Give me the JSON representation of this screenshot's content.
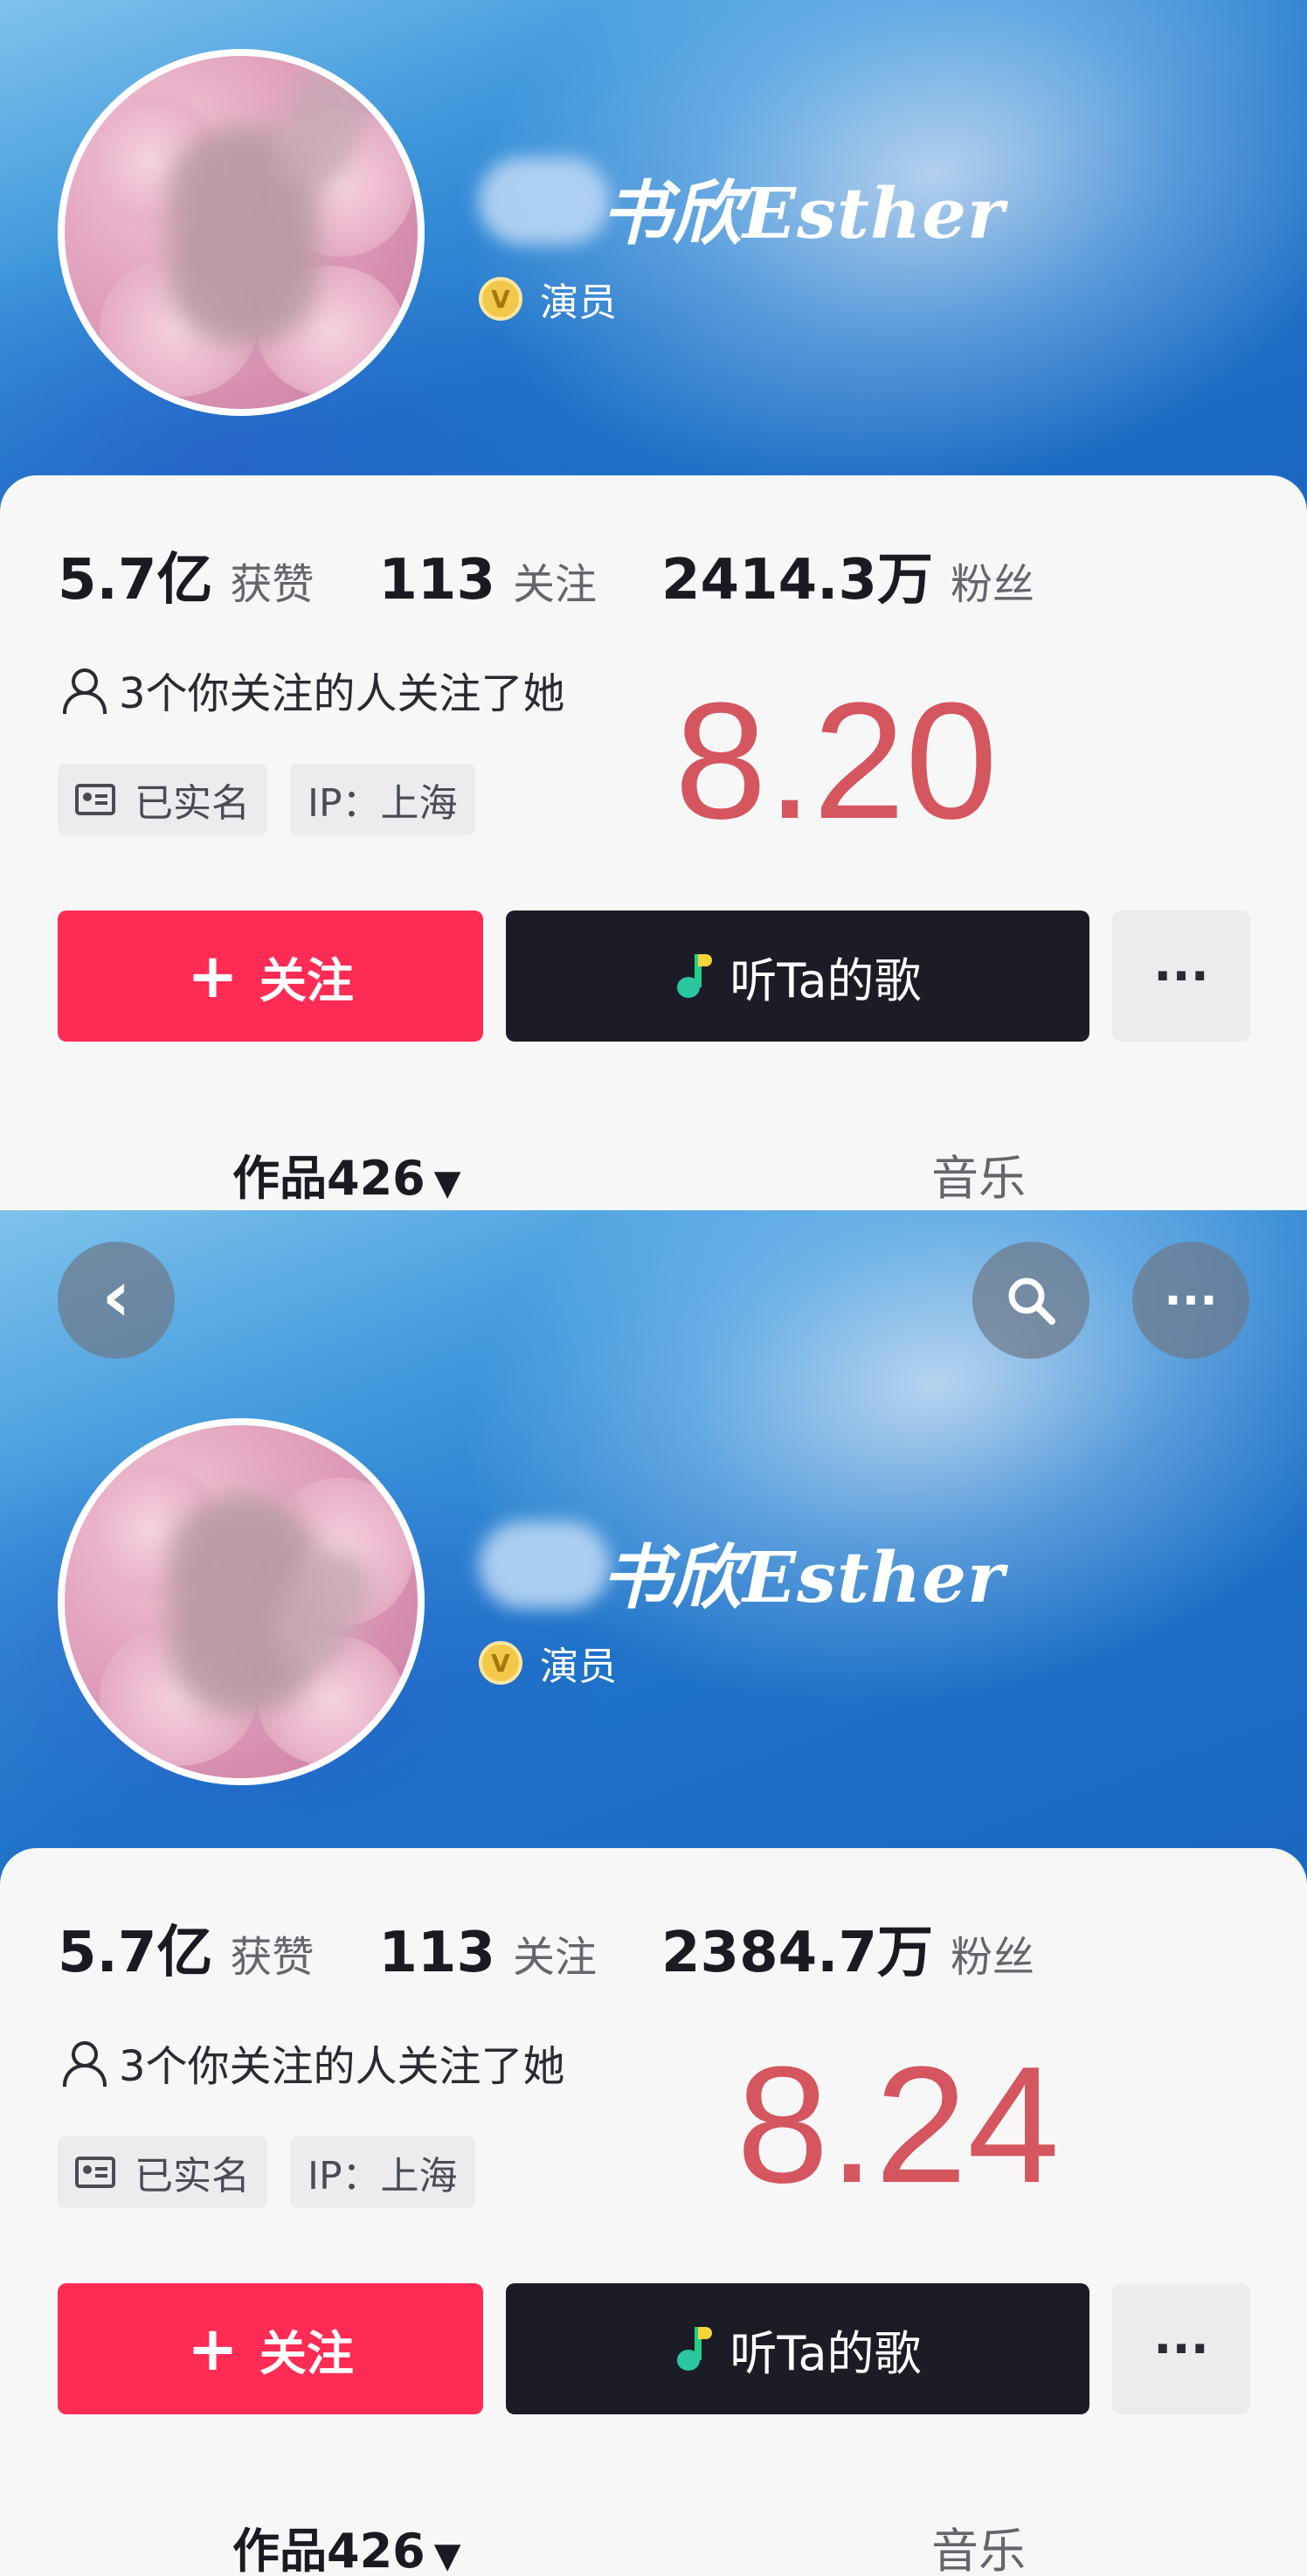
{
  "top": {
    "name": "书欣Esther",
    "title": "演员",
    "verified_badge": "V",
    "stats": {
      "likes": {
        "value": "5.7亿",
        "label": "获赞"
      },
      "following": {
        "value": "113",
        "label": "关注"
      },
      "fans": {
        "value": "2414.3万",
        "label": "粉丝"
      }
    },
    "mutual": "3个你关注的人关注了她",
    "tags": {
      "verified": "已实名",
      "ip": "IP：上海"
    },
    "date_label": "8.20",
    "buttons": {
      "plus": "+",
      "follow": "关注",
      "music": "听Ta的歌",
      "more": "···"
    },
    "tabs": {
      "works": "作品426",
      "music": "音乐"
    }
  },
  "bottom": {
    "nav": {
      "back": "‹",
      "more": "···"
    },
    "name": "书欣Esther",
    "title": "演员",
    "verified_badge": "V",
    "stats": {
      "likes": {
        "value": "5.7亿",
        "label": "获赞"
      },
      "following": {
        "value": "113",
        "label": "关注"
      },
      "fans": {
        "value": "2384.7万",
        "label": "粉丝"
      }
    },
    "mutual": "3个你关注的人关注了她",
    "tags": {
      "verified": "已实名",
      "ip": "IP：上海"
    },
    "date_label": "8.24",
    "buttons": {
      "plus": "+",
      "follow": "关注",
      "music": "听Ta的歌",
      "more": "···"
    },
    "tabs": {
      "works": "作品426",
      "music": "音乐"
    }
  },
  "colors": {
    "follow": "#fe2c55",
    "music_button": "#1c1c26",
    "date_label": "#d5565e",
    "banner": "#1f73c9"
  },
  "icons": [
    "back-icon",
    "search-icon",
    "more-icon",
    "verified-badge-icon",
    "person-icon",
    "id-card-icon",
    "music-note-icon",
    "caret-down-icon"
  ]
}
